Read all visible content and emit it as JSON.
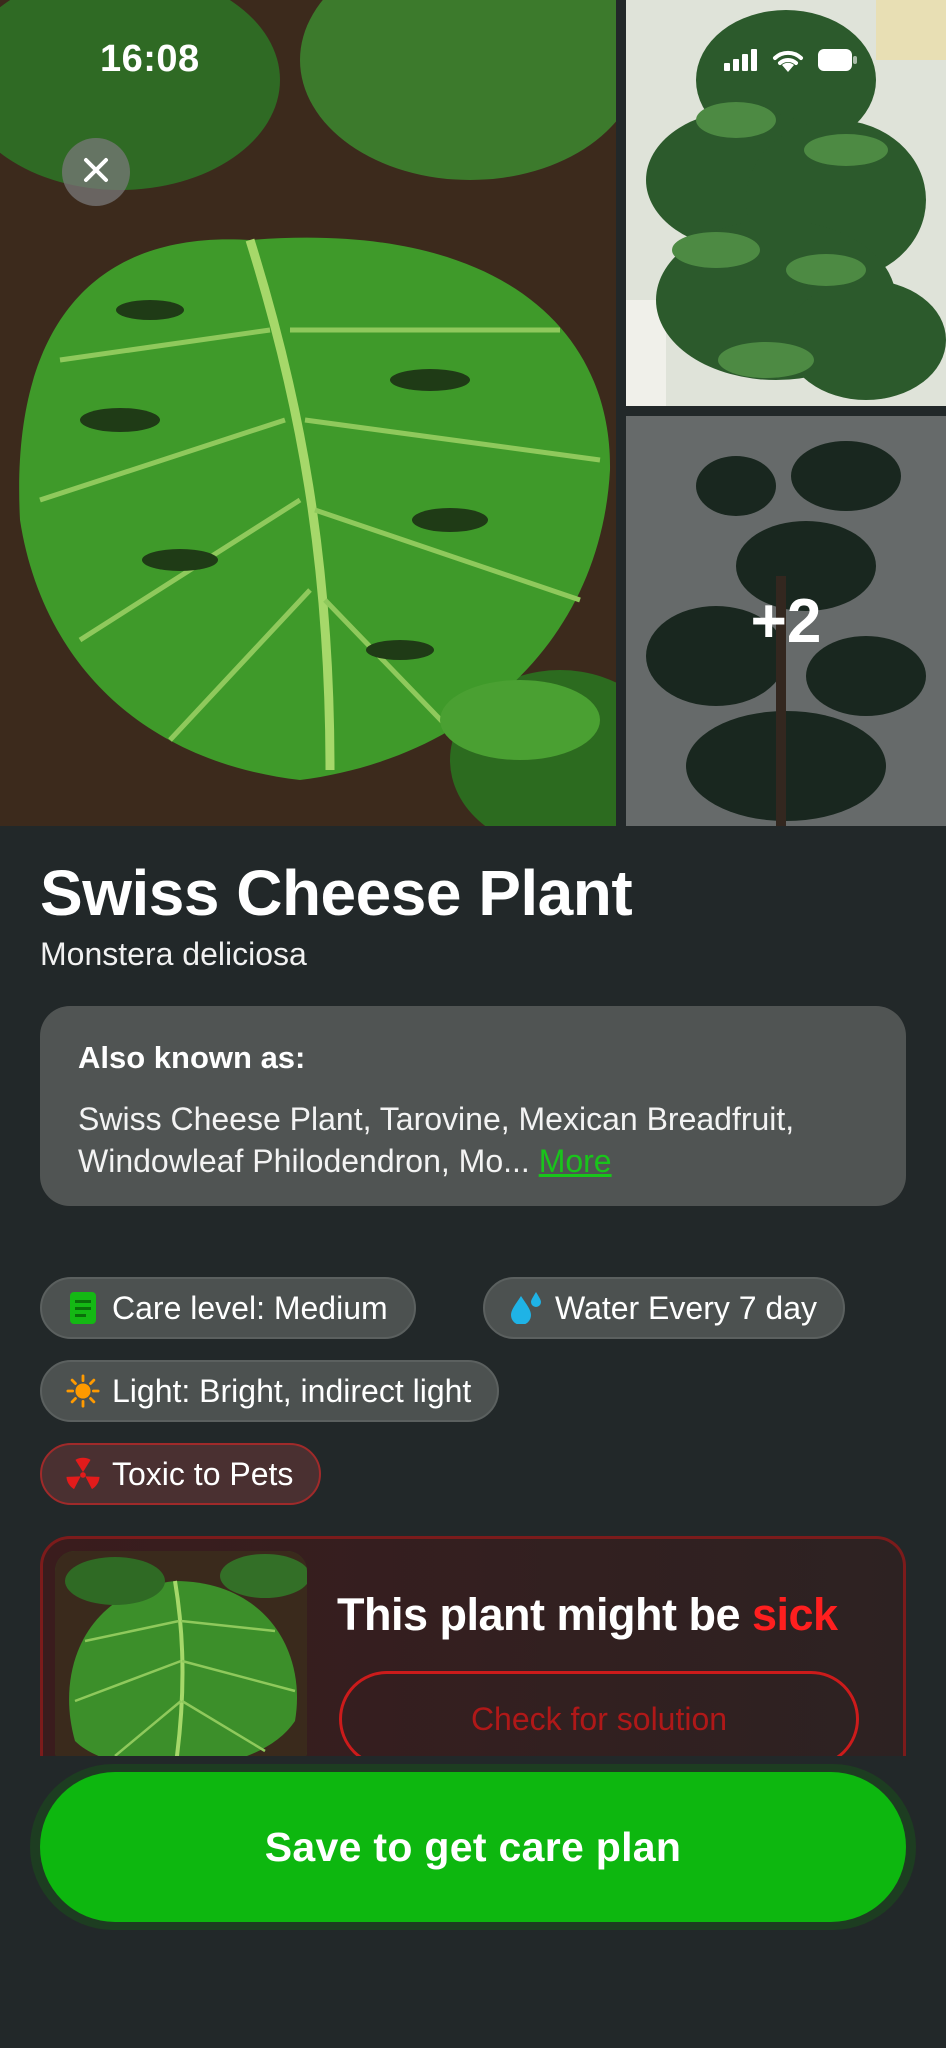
{
  "status_bar": {
    "time": "16:08"
  },
  "gallery": {
    "more_count_label": "+2"
  },
  "plant": {
    "common_name": "Swiss Cheese Plant",
    "scientific_name": "Monstera deliciosa"
  },
  "also_known_as": {
    "title": "Also known as:",
    "text": "Swiss Cheese Plant, Tarovine, Mexican Breadfruit, Windowleaf Philodendron, Mo...",
    "more_label": "More"
  },
  "chips": {
    "care_level": "Care level: Medium",
    "water": "Water Every 7 day",
    "light": "Light: Bright, indirect light",
    "toxic": "Toxic to Pets"
  },
  "health": {
    "title_prefix": "This plant might be ",
    "title_highlight": "sick",
    "solution_button": "Check for solution"
  },
  "cta": {
    "save_label": "Save to get care plan"
  },
  "colors": {
    "background": "#222829",
    "card": "#505453",
    "accent_green": "#0db70f",
    "link_green": "#19c41b",
    "alert_red": "#ff1f1f"
  },
  "icons": [
    "close-icon",
    "signal-icon",
    "wifi-icon",
    "battery-icon",
    "care-level-icon",
    "water-drop-icon",
    "sun-icon",
    "toxic-icon"
  ]
}
